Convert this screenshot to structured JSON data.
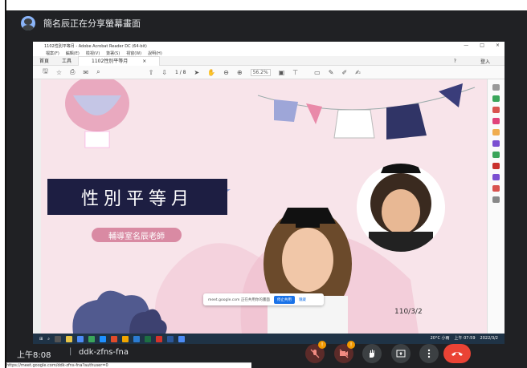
{
  "meet": {
    "presenter_text": "簡名辰正在分享螢幕畫面",
    "time": "上午8:08",
    "separator": "|",
    "meeting_code": "ddk-zfns-fna",
    "mic_badge": "!",
    "cam_badge": "!",
    "url": "https://meet.google.com/ddk-zfns-fna?authuser=0"
  },
  "acrobat": {
    "title": "1102性別平等月 - Adobe Acrobat Reader DC (64-bit)",
    "menu": [
      "檔案(F)",
      "編輯(E)",
      "檢視(V)",
      "簽署(S)",
      "視窗(W)",
      "說明(H)"
    ],
    "tabs": {
      "home": "首頁",
      "tools": "工具",
      "doc": "1102性別平等月",
      "close": "×",
      "signin": "登入",
      "help": "?"
    },
    "window_controls": [
      "—",
      "□",
      "×"
    ],
    "page_current": "1",
    "page_total": "/ 8",
    "zoom": "56.2%"
  },
  "slide": {
    "title": "性別平等月",
    "subtitle": "輔導室名辰老師",
    "date": "110/3/2"
  },
  "sharepopup": {
    "text": "meet.google.com 正在共用你的畫面",
    "stop": "停止共用",
    "hide": "隱藏"
  },
  "taskbar": {
    "weather": "20°C 小雨",
    "clock": "上午 07:59",
    "date": "2022/3/2"
  }
}
